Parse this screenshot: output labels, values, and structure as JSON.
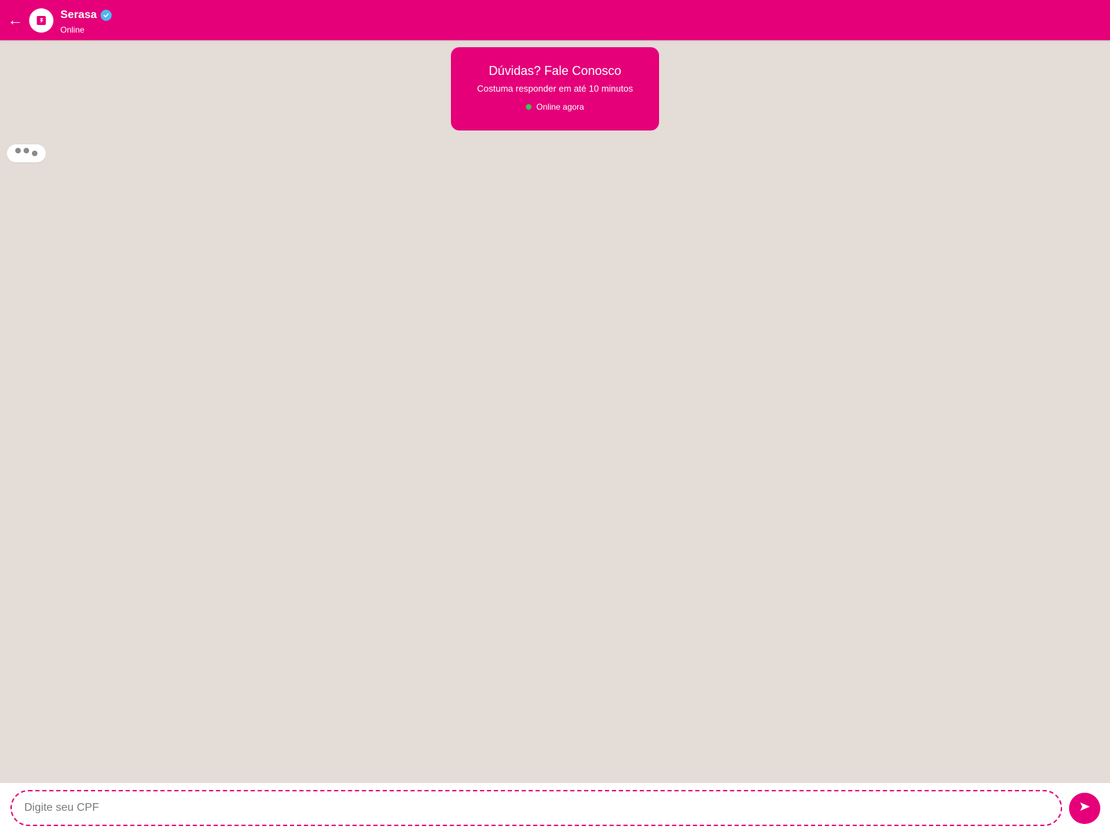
{
  "header": {
    "back_icon": "arrow-left-icon",
    "back_glyph": "←",
    "avatar_icon": "serasa-logo",
    "contact_name": "Serasa",
    "verified_icon": "verified-check-icon",
    "status": "Online"
  },
  "info_card": {
    "title": "Dúvidas? Fale Conosco",
    "subtitle": "Costuma responder em até 10 minutos",
    "online_text": "Online agora"
  },
  "typing_indicator": {
    "icon": "typing-dots-icon"
  },
  "composer": {
    "placeholder": "Digite seu CPF",
    "value": "",
    "send_icon": "send-icon",
    "send_glyph": "➤"
  },
  "colors": {
    "brand": "#e5007a",
    "chat_background": "#e4dcd6",
    "online_dot": "#2ecc55",
    "verified": "#4fb8f0"
  }
}
